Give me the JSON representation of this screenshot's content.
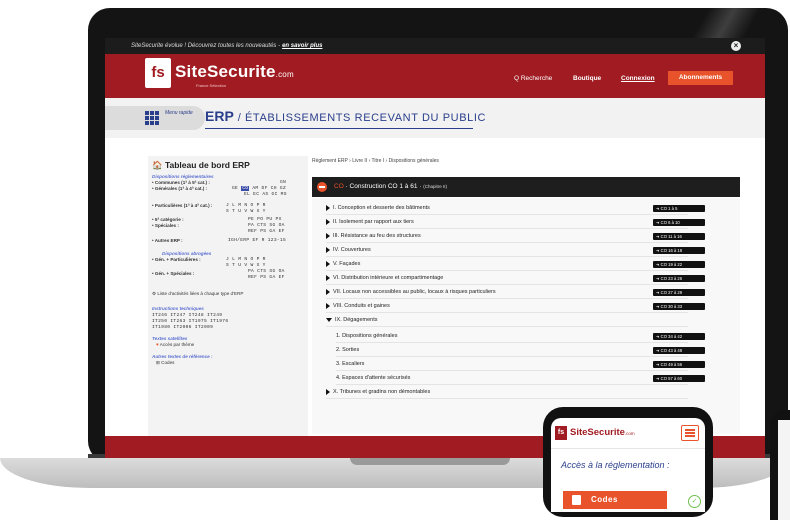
{
  "topbar": {
    "message": "SiteSecurite évolue ! Découvrez toutes les nouveautés -",
    "link": "en savoir plus",
    "close": "×"
  },
  "header": {
    "logo_mark": "fs",
    "logo_name": "SiteSecurite",
    "logo_tld": ".com",
    "logo_sub": "France Sélection",
    "nav_search": "Q Recherche",
    "nav_shop": "Boutique",
    "nav_login": "Connexion",
    "nav_subscribe": "Abonnements"
  },
  "title": {
    "menu_label": "Menu rapide",
    "erp": "ERP",
    "subtitle": "/ ÉTABLISSEMENTS RECEVANT DU PUBLIC"
  },
  "dashboard": {
    "title": "Tableau de bord ERP",
    "reg_heading": "Dispositions réglementaires",
    "communes": "• Communes (1ª à 5ª cat.) :",
    "communes_codes": "GN",
    "generales": "• Générales (1ª à 4ª cat.) :",
    "generales_codes_1": "GE",
    "generales_codes_hl": "CO",
    "generales_codes_2": "AM DF CH GZ",
    "generales_row2": "EL EC AS GC MS",
    "particulieres": "• Particulières (1ª à 4ª cat.) :",
    "part_row1": "J L M N O P R",
    "part_row2": "S T U V W X Y",
    "cat5": "• 5ª catégorie :",
    "cat5_codes": "PE PO PU PX",
    "speciales": "• Spéciales :",
    "spec_row1": "PA CTS SG OA",
    "spec_row2": "REF PS GA EF",
    "autres": "• Autres ERP :",
    "autres_codes": "IGH/ERP  EF  R 123-15",
    "repealed_heading": "Dispositions abrogées",
    "rep_part": "• Gén. + Particulières :",
    "rep_part_row1": "J L M N O P R",
    "rep_part_row2": "S T U V W X Y",
    "rep_spec": "• Gén. + Spéciales :",
    "rep_spec_row1": "PA CTS SG OA",
    "rep_spec_row2": "REF PS GA EF",
    "activity_list": "Liste d'activités liées à chaque type d'ERP",
    "instructions_heading": "Instructions techniques",
    "it_row1": "IT246   IT247   IT248   IT249",
    "it_row2": "IT250   IT263   IT1975   IT1976",
    "it_row3": "IT1980   IT2006   IT2009",
    "satellite_heading": "Textes satellites",
    "satellite_item": "Accès par thème",
    "other_heading": "Autres textes de référence :",
    "other_item": "Codes"
  },
  "content": {
    "breadcrumb": "Règlement ERP › Livre II › Titre I › Dispositions générales",
    "section_code": "CO",
    "section_title": " · Construction CO 1 à 61 ·",
    "section_chapter": "(Chapitre II)",
    "rows": [
      {
        "label": "I. Conception et desserte des bâtiments",
        "pill": "➔ CO 1 à 5"
      },
      {
        "label": "II. Isolement par rapport aux tiers",
        "pill": "➔ CO 6 à 10"
      },
      {
        "label": "III. Résistance au feu des structures",
        "pill": "➔ CO 11 à 16"
      },
      {
        "label": "IV. Couvertures",
        "pill": "➔ CO 16 à 18"
      },
      {
        "label": "V. Façades",
        "pill": "➔ CO 19 à 22"
      },
      {
        "label": "VI. Distribution intérieure et compartimentage",
        "pill": "➔ CO 23 à 26"
      },
      {
        "label": "VII. Locaux non accessibles au public, locaux à risques particuliers",
        "pill": "➔ CO 27 à 29"
      },
      {
        "label": "VIII. Conduits et gaines",
        "pill": "➔ CO 30 à 33"
      },
      {
        "label": "IX. Dégagements",
        "pill": ""
      },
      {
        "label": "1. Dispositions générales",
        "pill": "➔ CO 34 à 42"
      },
      {
        "label": "2. Sorties",
        "pill": "➔ CO 43 à 48"
      },
      {
        "label": "3. Escaliers",
        "pill": "➔ CO 49 à 56"
      },
      {
        "label": "4. Espaces d'attente sécurisés",
        "pill": "➔ CO 57 à 60"
      },
      {
        "label": "X. Tribunes et gradins non démontables",
        "pill": ""
      }
    ]
  },
  "phone": {
    "logo_mark": "fs",
    "logo_name": "SiteSecurite",
    "logo_tld": ".com",
    "heading": "Accès à la réglementation :",
    "button": "Codes"
  },
  "colors": {
    "brand_red": "#a01c22",
    "accent_orange": "#e8532b",
    "navy": "#2a3f8c"
  }
}
